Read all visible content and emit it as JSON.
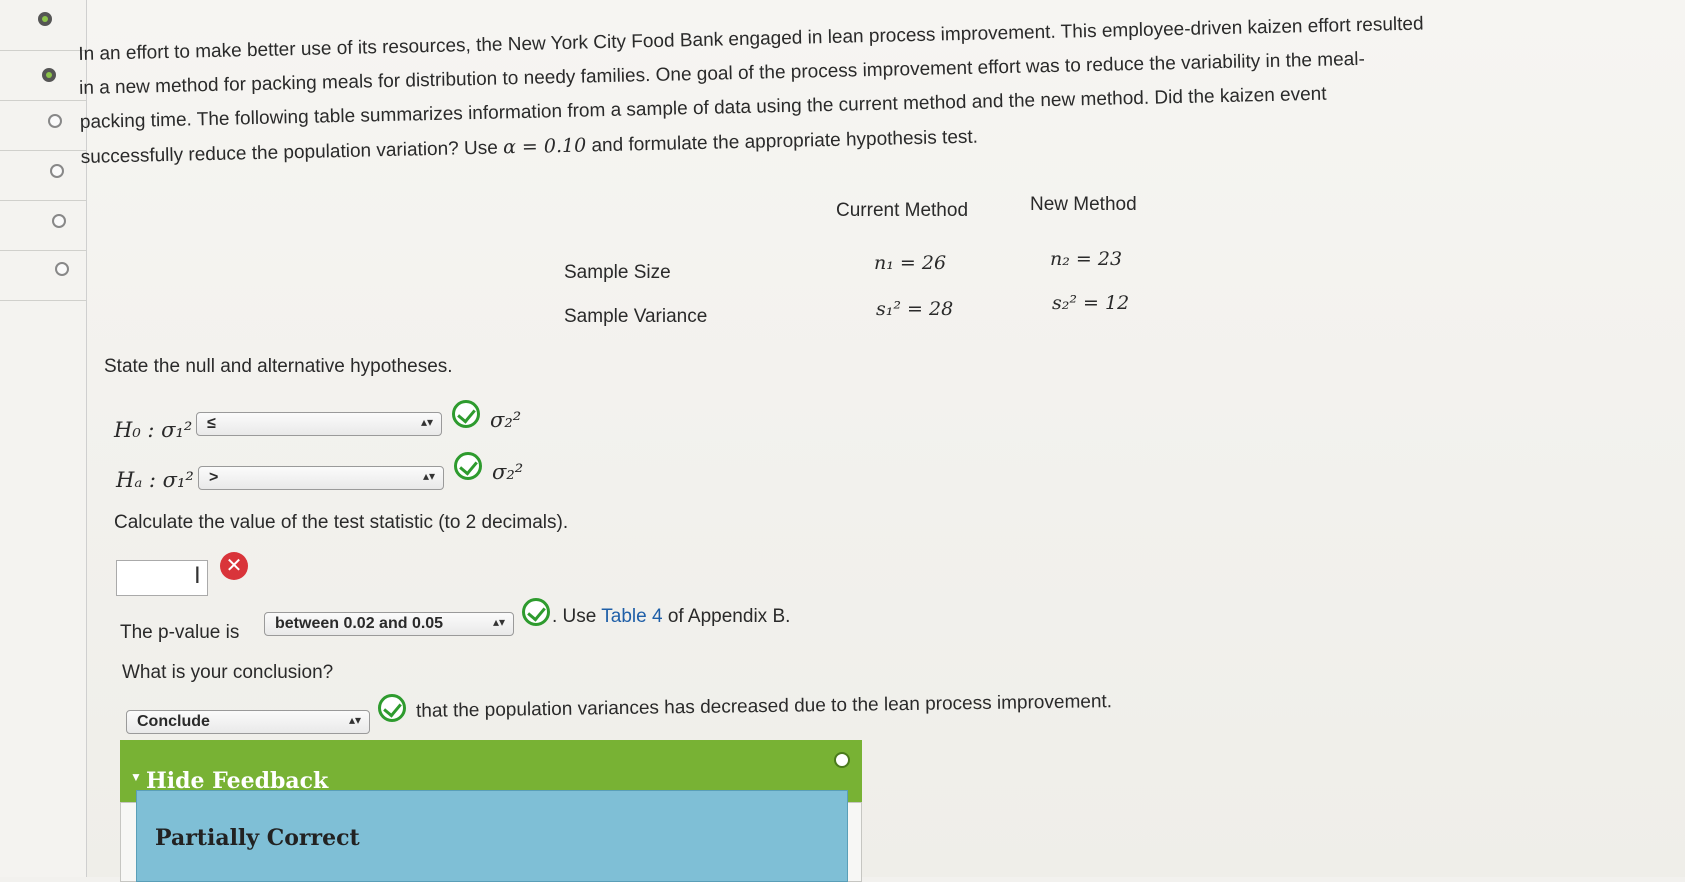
{
  "question": {
    "lines": [
      "In an effort to make better use of its resources, the New York City Food Bank engaged in lean process improvement. This employee-driven kaizen effort resulted",
      "in a new method for packing meals for distribution to needy families. One goal of the process improvement effort was to reduce the variability in the meal-",
      "packing time. The following table summarizes information from a sample of data using the current method and the new method. Did the kaizen event",
      "successfully reduce the population variation? Use"
    ],
    "alpha": "α = 0.10",
    "tail": "and formulate the appropriate hypothesis test."
  },
  "table": {
    "col1": "Current Method",
    "col2": "New Method",
    "row1_label": "Sample Size",
    "row2_label": "Sample Variance",
    "n1": "n₁ = 26",
    "n2": "n₂ = 23",
    "s1": "s₁² = 28",
    "s2": "s₂² = 12"
  },
  "hypotheses": {
    "prompt": "State the null and alternative hypotheses.",
    "h0_label": "H₀ : σ₁²",
    "h0_value": "≤",
    "ha_label": "Hₐ : σ₁²",
    "ha_value": ">",
    "rhs": "σ₂²"
  },
  "statistic": {
    "prompt": "Calculate the value of the test statistic (to 2 decimals).",
    "value": "",
    "status": "incorrect"
  },
  "pvalue": {
    "prefix": "The p-value is",
    "selected": "between 0.02 and 0.05",
    "suffix": ". Use",
    "link": "Table 4",
    "tail": "of Appendix B."
  },
  "conclusion": {
    "prompt": "What is your conclusion?",
    "selected": "Conclude",
    "tail": "that the population variances has decreased due to the lean process improvement."
  },
  "feedback": {
    "toggle": "Hide Feedback",
    "status": "Partially Correct"
  }
}
